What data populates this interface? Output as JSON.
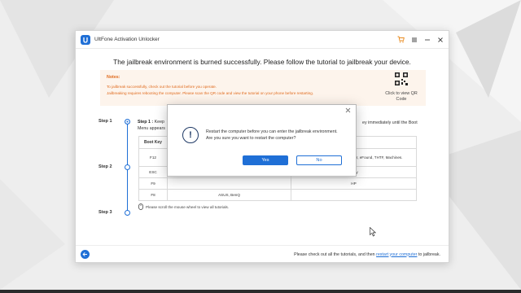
{
  "window": {
    "title": "UltFone Activation Unlocker",
    "icons": [
      "cart-icon",
      "menu-icon",
      "minimize-icon",
      "close-icon"
    ]
  },
  "headline": "The jailbreak environment is burned successfully. Please follow the tutorial to jailbreak your device.",
  "notes": {
    "title": "Notes:",
    "line1": "To jailbreak successfully, check out the tutorial before you operate.",
    "line2": "Jailbreaking requires rebooting the computer. Please scan the QR code and view the tutorial on your phone before restarting.",
    "qr_label": "Click to view QR Code"
  },
  "steps": {
    "step1": "Step 1",
    "step2": "Step 2",
    "step3": "Step 3",
    "step1_lead": "Step 1 :",
    "step1_text_a": "Keep",
    "step1_text_b": "Menu appears",
    "step1_text_right": "ey immediately until the Boot"
  },
  "boot_table": {
    "header_key": "Boot Key",
    "header_right": "p",
    "rows": [
      {
        "key": "F12",
        "mid": "",
        "right": "BYTE, Gateway, Toshiba, Haier, Haier, eFound, THTF, Machines."
      },
      {
        "key": "ESC",
        "mid": "",
        "right": "Sony"
      },
      {
        "key": "F9",
        "mid": "",
        "right": "HP"
      },
      {
        "key": "F8",
        "mid": "ASUS, BenQ",
        "right": ""
      }
    ]
  },
  "mouse_hint": "Please scroll the mouse wheel to view all tutorials.",
  "footer": {
    "text_before": "Please check out all the tutorials, and then",
    "link": "restart your computer",
    "text_after": "to jailbreak."
  },
  "modal": {
    "line1": "Restart the computer before you can enter the jailbreak environment.",
    "line2": "Are you sure you want to restart the computer?",
    "yes": "Yes",
    "no": "No"
  },
  "colors": {
    "accent": "#1f6fd6",
    "notes_text": "#e06b1e",
    "notes_bg": "#fdf4ec"
  }
}
